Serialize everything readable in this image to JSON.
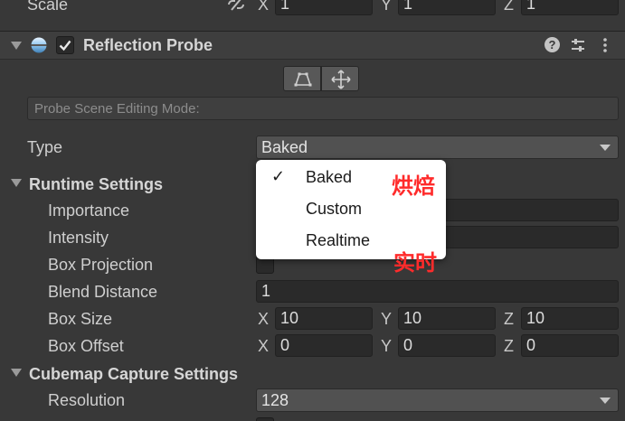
{
  "scale_row": {
    "label": "Scale",
    "x_axis": "X",
    "x_value": "1",
    "y_axis": "Y",
    "y_value": "1",
    "z_axis": "Z",
    "z_value": "1"
  },
  "component": {
    "title": "Reflection Probe",
    "enabled": true
  },
  "editing_mode_placeholder": "Probe Scene Editing Mode:",
  "type_row": {
    "label": "Type",
    "value": "Baked"
  },
  "runtime_settings": {
    "title": "Runtime Settings",
    "importance_label": "Importance",
    "intensity_label": "Intensity",
    "box_projection_label": "Box Projection",
    "blend_distance_label": "Blend Distance",
    "blend_distance_value": "1",
    "box_size_label": "Box Size",
    "box_size": {
      "x_axis": "X",
      "x": "10",
      "y_axis": "Y",
      "y": "10",
      "z_axis": "Z",
      "z": "10"
    },
    "box_offset_label": "Box Offset",
    "box_offset": {
      "x_axis": "X",
      "x": "0",
      "y_axis": "Y",
      "y": "0",
      "z_axis": "Z",
      "z": "0"
    }
  },
  "cubemap_capture": {
    "title": "Cubemap Capture Settings",
    "resolution_label": "Resolution",
    "resolution_value": "128"
  },
  "type_popup": {
    "items": [
      "Baked",
      "Custom",
      "Realtime"
    ],
    "selected": "Baked",
    "check_mark": "✓"
  },
  "annotations": {
    "baked_note": "烘焙",
    "realtime_note": "实时"
  },
  "colors": {
    "background": "#383838",
    "annotation": "#ff2b2b",
    "popup_bg": "#ffffff"
  }
}
